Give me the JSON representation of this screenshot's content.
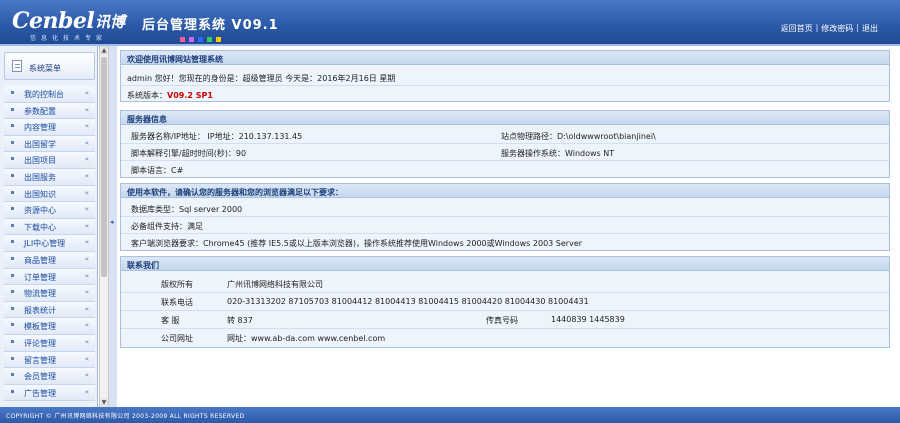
{
  "header": {
    "logo_en": "Cenbel",
    "logo_cn": "讯博",
    "slogan": "信息化技术专家",
    "title": "后台管理系统 V09.1",
    "swatches": [
      "#ff5a9a",
      "#cc66ff",
      "#3366ff",
      "#33cc66",
      "#ffcc00"
    ],
    "links": [
      "返回首页",
      "修改密码",
      "退出"
    ],
    "link_sep": "|"
  },
  "sidebar": {
    "title": "系统菜单",
    "arrow": "«",
    "items": [
      {
        "label": "我的控制台"
      },
      {
        "label": "参数配置"
      },
      {
        "label": "内容管理"
      },
      {
        "label": "出国留学"
      },
      {
        "label": "出国项目"
      },
      {
        "label": "出国服务"
      },
      {
        "label": "出国知识"
      },
      {
        "label": "资源中心"
      },
      {
        "label": "下载中心"
      },
      {
        "label": "JLI中心管理"
      },
      {
        "label": "商品管理"
      },
      {
        "label": "订单管理"
      },
      {
        "label": "物流管理"
      },
      {
        "label": "报表统计"
      },
      {
        "label": "模板管理"
      },
      {
        "label": "评论管理"
      },
      {
        "label": "留言管理"
      },
      {
        "label": "会员管理"
      },
      {
        "label": "广告管理"
      }
    ]
  },
  "welcome": {
    "title": "欢迎使用讯博网站管理系统",
    "greeting": "admin 您好！您现在的身份是：超级管理员 今天是：2016年2月16日 星期",
    "version_label": "系统版本：",
    "version_value": "V09.2 SP1"
  },
  "server": {
    "title": "服务器信息",
    "ip": "服务器名称/IP地址：  IP地址：210.137.131.45",
    "path": "站点物理路径：D:\\oldwwwroot\\bianjinei\\",
    "time": "脚本解释引擎/超时时间(秒)：90",
    "os": "服务器操作系统：Windows NT",
    "lang": "脚本语言：C#"
  },
  "requirements": {
    "title": "使用本软件，请确认您的服务器和您的浏览器满足以下要求：",
    "db": "数据库类型：Sql server 2000",
    "components": "必备组件支持：满足",
    "client": "客户端浏览器要求：Chrome45 (推荐 IE5.5或以上版本浏览器)，操作系统推荐使用Windows 2000或Windows 2003 Server"
  },
  "contact": {
    "title": "联系我们",
    "company_label": "版权所有",
    "company_value": "广州讯博网络科技有限公司",
    "phone_label": "联系电话",
    "phone_value": "020-31313202 87105703 81004412 81004413 81004415 81004420 81004430 81004431",
    "qq_label": "客  服",
    "qq_value": "转 837",
    "fax_label": "传真号码",
    "fax_value": "1440839 1445839",
    "web_label": "公司网址",
    "web_value": "网址：www.ab-da.com   www.cenbel.com"
  },
  "footer": {
    "text": "COPYRIGHT © 广州讯博网络科技有限公司 2003-2009 ALL RIGHTS RESERVED"
  }
}
